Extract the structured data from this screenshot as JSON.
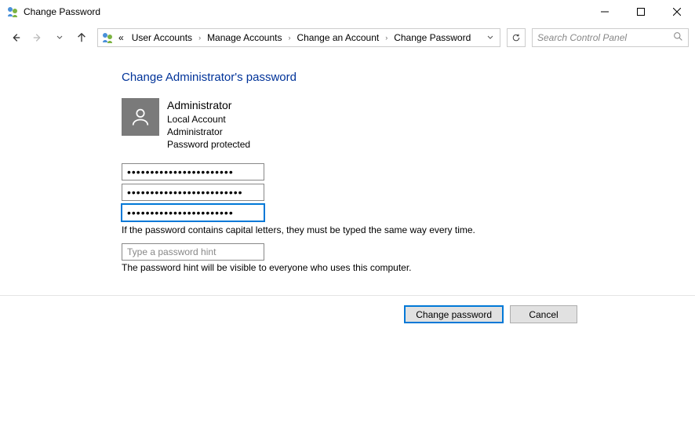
{
  "window": {
    "title": "Change Password"
  },
  "breadcrumb": {
    "prefix": "«",
    "items": [
      "User Accounts",
      "Manage Accounts",
      "Change an Account",
      "Change Password"
    ]
  },
  "search": {
    "placeholder": "Search Control Panel"
  },
  "page": {
    "heading": "Change Administrator's password"
  },
  "account": {
    "name": "Administrator",
    "type": "Local Account",
    "role": "Administrator",
    "protection": "Password protected"
  },
  "fields": {
    "current_password": "•••••••••••••••••••••••",
    "new_password": "•••••••••••••••••••••••••",
    "confirm_password": "•••••••••••••••••••••••",
    "password_help": "If the password contains capital letters, they must be typed the same way every time.",
    "hint_placeholder": "Type a password hint",
    "hint_value": "",
    "hint_help": "The password hint will be visible to everyone who uses this computer."
  },
  "buttons": {
    "primary": "Change password",
    "cancel": "Cancel"
  }
}
